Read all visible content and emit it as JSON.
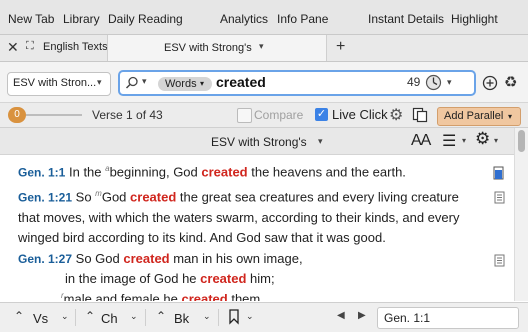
{
  "menu": {
    "new_tab": "New Tab",
    "library": "Library",
    "daily_reading": "Daily Reading",
    "analytics": "Analytics",
    "info_pane": "Info Pane",
    "instant_details": "Instant Details",
    "highlight": "Highlight"
  },
  "tabs": {
    "left_label": "English Texts",
    "active_label": "ESV with Strong's",
    "add": "+"
  },
  "toolbar": {
    "resource": "ESV with Stron...",
    "search_mode": "Words",
    "search_query": "created",
    "hit_count": "49"
  },
  "subbar": {
    "counter": "0",
    "verse_position": "Verse 1 of 43",
    "compare_label": "Compare",
    "live_click_label": "Live Click",
    "compare_checked": false,
    "live_click_checked": true,
    "add_parallel_label": "Add Parallel"
  },
  "header": {
    "title": "ESV with Strong's",
    "font_size_label": "AA"
  },
  "text": {
    "v1_ref": "Gen. 1:1",
    "v1_a": "In the ",
    "v1_fn": "a",
    "v1_b": "beginning, God ",
    "v1_hl": "created",
    "v1_c": " the heavens and the earth.",
    "v21_ref": "Gen. 1:21",
    "v21_a": "So ",
    "v21_fn": "m",
    "v21_b": "God ",
    "v21_hl": "created",
    "v21_c": " the great sea creatures and every living creature",
    "v21_line2": "that moves, with which the waters swarm, according to their kinds, and every",
    "v21_line3": "winged bird according to its kind. And God saw that it was good.",
    "v27_ref": "Gen. 1:27",
    "v27_a": "So God ",
    "v27_hl": "created",
    "v27_b": " man in his own image,",
    "v27_l2a": "in the image of God he ",
    "v27_l2hl": "created",
    "v27_l2b": " him;",
    "v27_l3fn": "r",
    "v27_l3a": "male and female he ",
    "v27_l3hl": "created",
    "v27_l3b": " them."
  },
  "bottom": {
    "vs": "Vs",
    "ch": "Ch",
    "bk": "Bk",
    "reference": "Gen. 1:1"
  },
  "colors": {
    "highlight": "#d0261e",
    "reference": "#1a5e99",
    "accent": "#6aa3e8",
    "parallel_button": "#f0c7a0",
    "counter_badge": "#d9923f"
  }
}
